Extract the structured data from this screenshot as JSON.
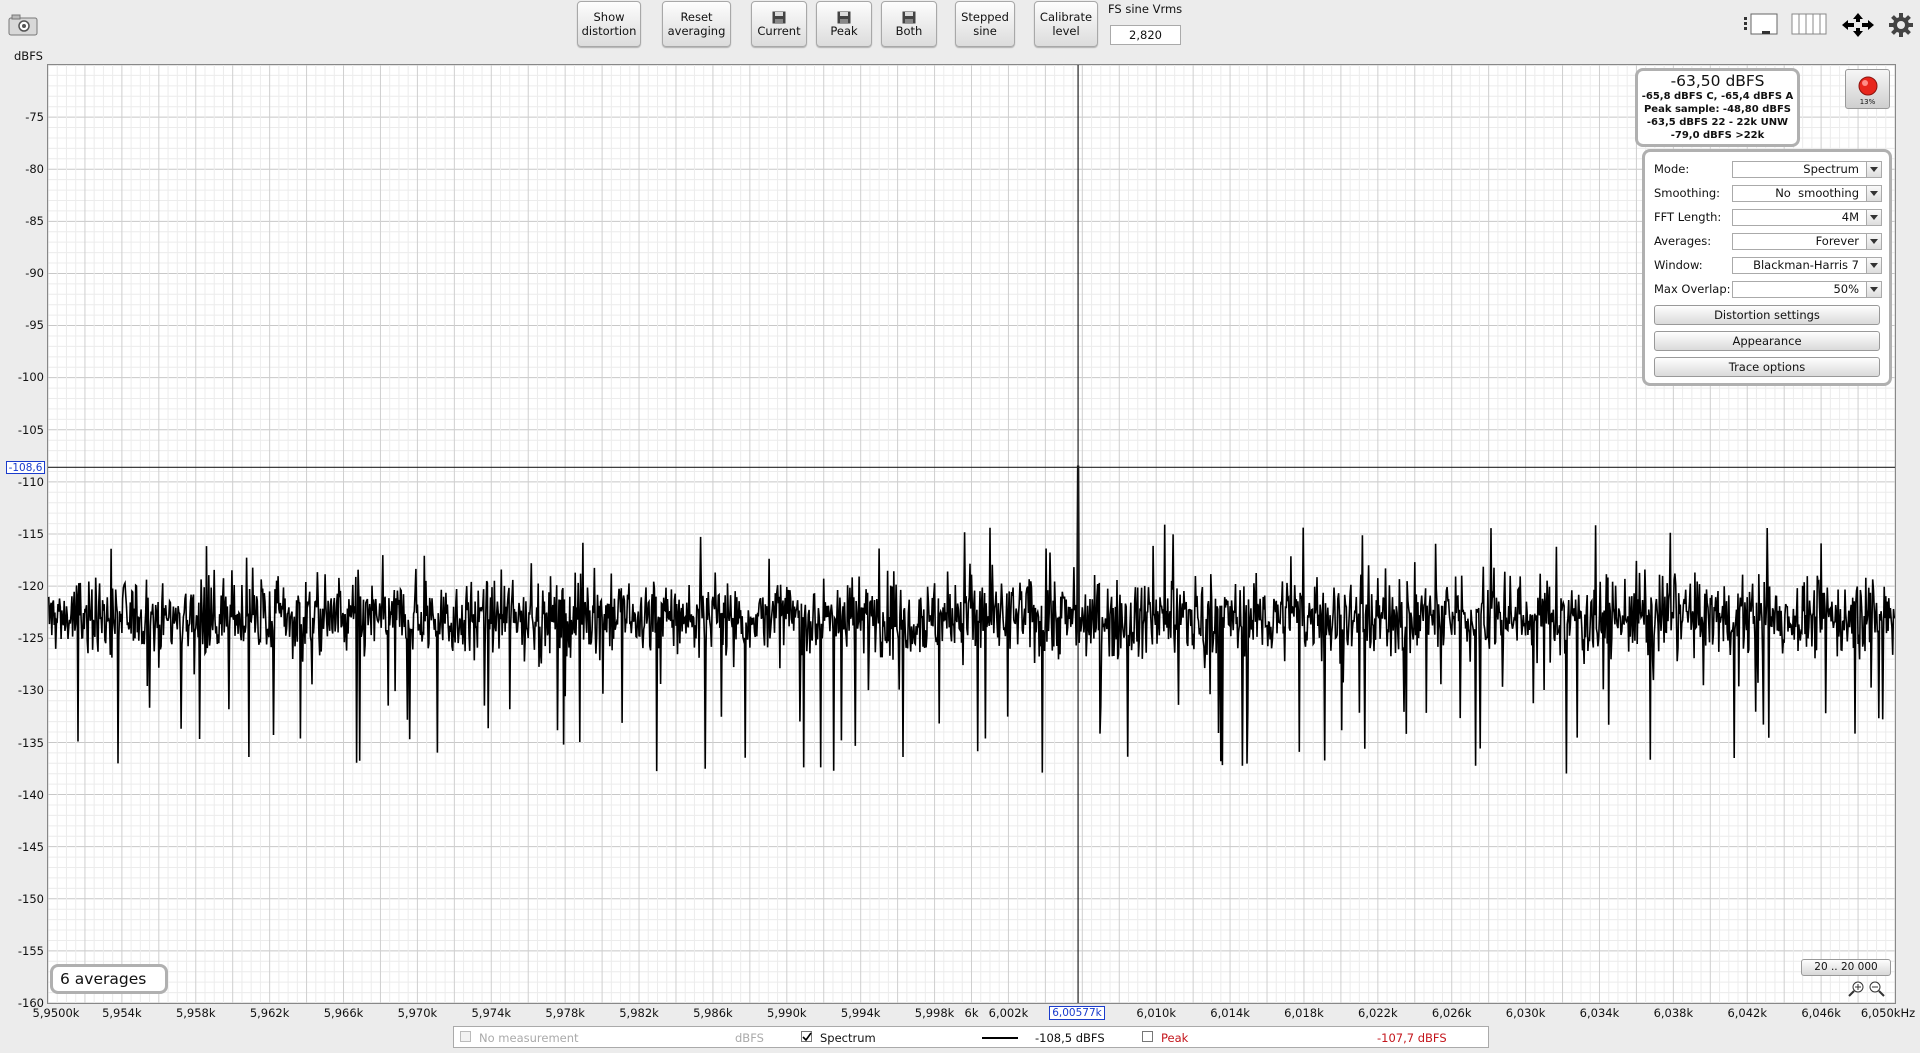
{
  "toolbar": {
    "show_distortion": [
      "Show",
      "distortion"
    ],
    "reset_averaging": [
      "Reset",
      "averaging"
    ],
    "save_current": "Current",
    "save_peak": "Peak",
    "save_both": "Both",
    "stepped_sine": [
      "Stepped",
      "sine"
    ],
    "calibrate_level": [
      "Calibrate",
      "level"
    ],
    "fs_label": "FS sine Vrms",
    "fs_value": "2,820"
  },
  "plot": {
    "y_unit": "dBFS",
    "cursor_y_label": "-108,6",
    "cursor_x_label": "6,00577k",
    "averages_badge": "6 averages",
    "range_button": "20 .. 20 000"
  },
  "level_box": {
    "main": "-63,50 dBFS",
    "line1": "-65,8 dBFS C, -65,4 dBFS A",
    "line2": "Peak sample: -48,80 dBFS",
    "line3": "-63,5 dBFS 22 - 22k UNW",
    "line4": "-79,0 dBFS >22k",
    "meter_percent": "13%"
  },
  "settings": {
    "mode_label": "Mode:",
    "mode_value": "Spectrum",
    "smoothing_label": "Smoothing:",
    "smoothing_value": "No  smoothing",
    "fft_label": "FFT Length:",
    "fft_value": "4M",
    "averages_label": "Averages:",
    "averages_value": "Forever",
    "window_label": "Window:",
    "window_value": "Blackman-Harris 7",
    "overlap_label": "Max Overlap:",
    "overlap_value": "50%",
    "distortion_settings": "Distortion settings",
    "appearance": "Appearance",
    "trace_options": "Trace options"
  },
  "legend": {
    "no_measurement": "No measurement",
    "no_measurement_unit": "dBFS",
    "spectrum": "Spectrum",
    "spectrum_value": "-108,5 dBFS",
    "peak": "Peak",
    "peak_value": "-107,7 dBFS"
  },
  "colors": {
    "trace": "#000000",
    "grid": "#d6d6d6",
    "cursor_label": "#1a3ccc",
    "peak_text": "#c4161c",
    "record": "#e8261c"
  },
  "icons": [
    "camera-icon",
    "floppy-disk-icon",
    "layout-single-icon",
    "layout-columns-icon",
    "fit-arrows-icon",
    "gear-icon",
    "zoom-in-icon",
    "zoom-out-icon",
    "record-icon"
  ],
  "chart_data": {
    "type": "line",
    "ylabel": "dBFS",
    "ylim": [
      -160,
      -70
    ],
    "xlim": [
      5950,
      6050
    ],
    "x_unit": "Hz (k)",
    "y_ticks": [
      "-75",
      "-80",
      "-85",
      "-90",
      "-95",
      "-100",
      "-105",
      "-110",
      "-115",
      "-120",
      "-125",
      "-130",
      "-135",
      "-140",
      "-145",
      "-150",
      "-155",
      "-160"
    ],
    "x_ticks": [
      "5,9500k",
      "5,954k",
      "5,958k",
      "5,962k",
      "5,966k",
      "5,970k",
      "5,974k",
      "5,978k",
      "5,982k",
      "5,986k",
      "5,990k",
      "5,994k",
      "5,998k",
      "6k",
      "6,002k",
      "6,006k",
      "6,010k",
      "6,014k",
      "6,018k",
      "6,022k",
      "6,026k",
      "6,030k",
      "6,034k",
      "6,038k",
      "6,042k",
      "6,046k",
      "6,050kHz"
    ],
    "cursor": {
      "x": 6005.77,
      "y": -108.6
    },
    "series": [
      {
        "name": "Spectrum",
        "noise_floor_mean": -123,
        "noise_floor_min": -138,
        "noise_floor_max": -114,
        "peak_x": 6005.77,
        "peak_y": -108.5
      }
    ],
    "grid": true
  }
}
